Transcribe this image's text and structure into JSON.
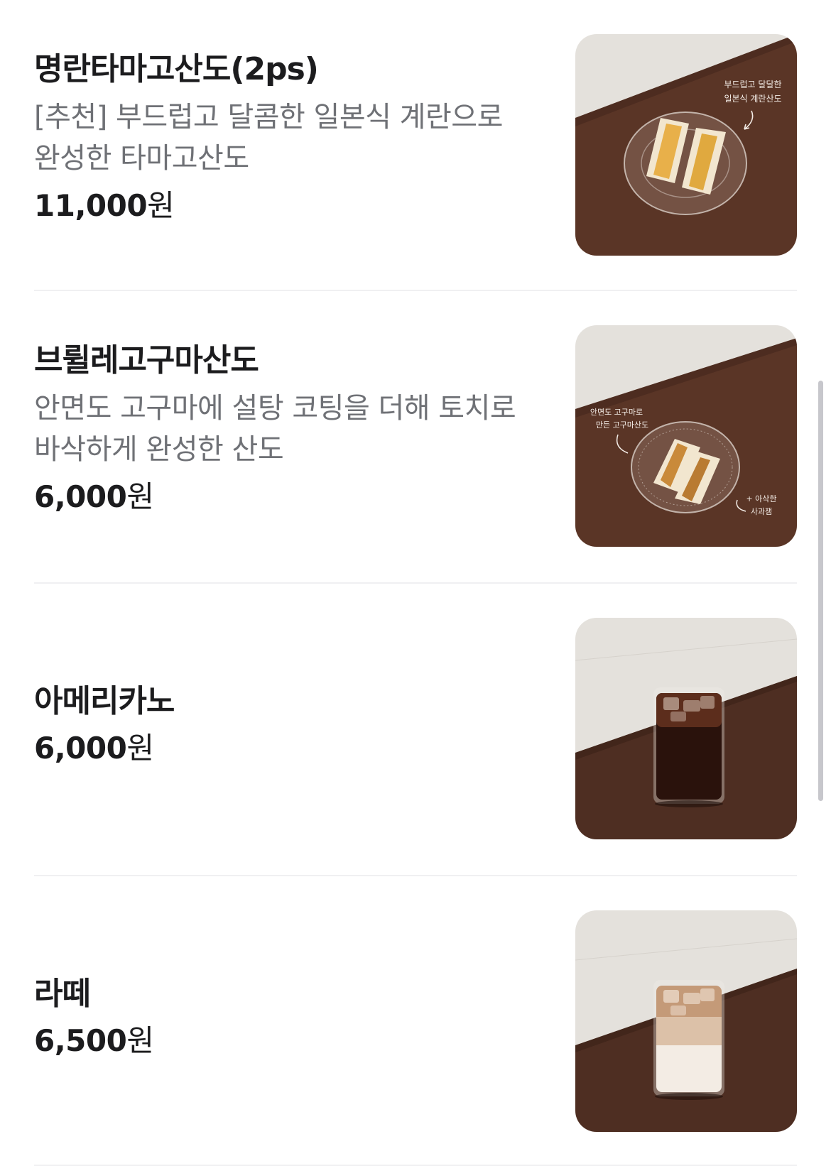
{
  "items": [
    {
      "name": "명란타마고산도(2ps)",
      "description_lines": [
        "[추천] 부드럽고 달콤한 일본식 계란으로",
        "완성한 타마고산도"
      ],
      "price": "11,000",
      "currency": "원",
      "photo_caption_lines": [
        "부드럽고 달달한",
        "일본식 계란산도"
      ]
    },
    {
      "name": "브륄레고구마산도",
      "description_lines": [
        "안면도 고구마에 설탕 코팅을 더해 토치로",
        "바삭하게 완성한 산도"
      ],
      "price": "6,000",
      "currency": "원",
      "photo_caption_lines": [
        "안면도 고구마로",
        "만든 고구마산도",
        "+ 아삭한",
        "사과잼"
      ]
    },
    {
      "name": "아메리카노",
      "description_lines": [],
      "price": "6,000",
      "currency": "원",
      "photo_caption_lines": []
    },
    {
      "name": "라떼",
      "description_lines": [],
      "price": "6,500",
      "currency": "원",
      "photo_caption_lines": []
    }
  ],
  "colors": {
    "text_primary": "#1c1c1e",
    "text_secondary": "#6f7176",
    "divider": "#f0f0f2",
    "table_wood": "#5a3526",
    "wall_stone": "#e4e1dc"
  }
}
